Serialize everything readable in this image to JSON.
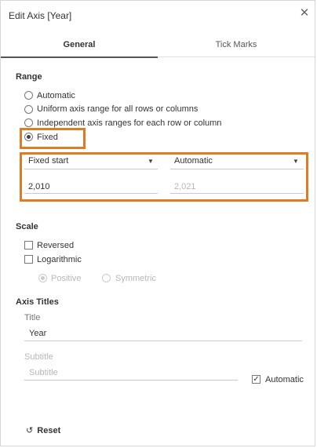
{
  "dialog": {
    "title": "Edit Axis [Year]"
  },
  "tabs": [
    {
      "label": "General",
      "active": true
    },
    {
      "label": "Tick Marks",
      "active": false
    }
  ],
  "range": {
    "heading": "Range",
    "options": [
      {
        "label": "Automatic",
        "selected": false
      },
      {
        "label": "Uniform axis range for all rows or columns",
        "selected": false
      },
      {
        "label": "Independent axis ranges for each row or column",
        "selected": false
      },
      {
        "label": "Fixed",
        "selected": true
      }
    ],
    "start_mode": "Fixed start",
    "end_mode": "Automatic",
    "start_value": "2,010",
    "end_value": "2,021"
  },
  "scale": {
    "heading": "Scale",
    "reversed_label": "Reversed",
    "reversed": false,
    "logarithmic_label": "Logarithmic",
    "logarithmic": false,
    "positive_label": "Positive",
    "symmetric_label": "Symmetric"
  },
  "axis_titles": {
    "heading": "Axis Titles",
    "title_label": "Title",
    "title_value": "Year",
    "subtitle_label": "Subtitle",
    "subtitle_placeholder": "Subtitle",
    "automatic_label": "Automatic",
    "automatic": true
  },
  "footer": {
    "reset_label": "Reset"
  },
  "colors": {
    "highlight": "#e07b25",
    "text": "#333333",
    "disabled": "#b7b7b7"
  }
}
